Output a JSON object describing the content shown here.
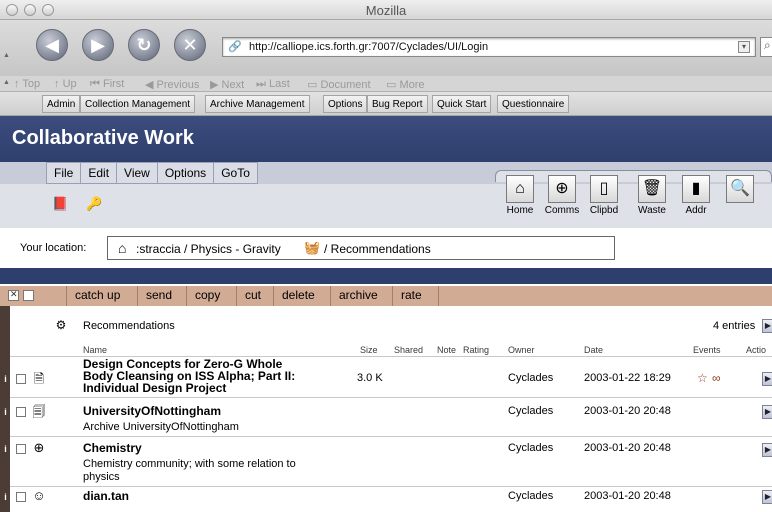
{
  "window": {
    "title": "Mozilla"
  },
  "nav": {
    "url": "http://calliope.ics.forth.gr:7007/Cyclades/UI/Login"
  },
  "sitenav": [
    "Top",
    "Up",
    "First",
    "Previous",
    "Next",
    "Last",
    "Document",
    "More"
  ],
  "ptoolbar": [
    "Admin",
    "Collection Management",
    "Archive Management",
    "Options",
    "Bug Report",
    "Quick Start",
    "Questionnaire"
  ],
  "header": {
    "title": "Collaborative Work"
  },
  "menu": [
    "File",
    "Edit",
    "View",
    "Options",
    "GoTo"
  ],
  "bigbuttons": [
    {
      "label": "Home",
      "icon": "home-icon"
    },
    {
      "label": "Comms",
      "icon": "globe-icon"
    },
    {
      "label": "Clipbd",
      "icon": "clipboard-icon"
    },
    {
      "label": "Waste",
      "icon": "trash-icon"
    },
    {
      "label": "Addr",
      "icon": "address-book-icon"
    },
    {
      "label": "",
      "icon": "search-icon"
    }
  ],
  "location": {
    "label": "Your location:",
    "path_part1": ":straccia / Physics - Gravity",
    "path_part2": "/ Recommendations"
  },
  "actions": [
    "catch up",
    "send",
    "copy",
    "cut",
    "delete",
    "archive",
    "rate"
  ],
  "table": {
    "title": "Recommendations",
    "count": "4 entries",
    "columns": [
      "Name",
      "Size",
      "Shared",
      "Note",
      "Rating",
      "Owner",
      "Date",
      "Events",
      "Actio"
    ],
    "rows": [
      {
        "name": "Design Concepts for Zero-G Whole Body Cleansing on ISS Alpha; Part II: Individual Design Project",
        "name_lines": [
          "Design Concepts for Zero-G Whole",
          "Body Cleansing on ISS Alpha; Part II:",
          "Individual Design Project"
        ],
        "size": "3.0 K",
        "owner": "Cyclades",
        "date": "2003-01-22 18:29",
        "icon": "document-icon"
      },
      {
        "name": "UniversityOfNottingham",
        "desc": "Archive UniversityOfNottingham",
        "owner": "Cyclades",
        "date": "2003-01-20 20:48",
        "icon": "archive-icon"
      },
      {
        "name": "Chemistry",
        "desc_lines": [
          "Chemistry community; with some relation to",
          "physics"
        ],
        "owner": "Cyclades",
        "date": "2003-01-20 20:48",
        "icon": "community-globe-icon"
      },
      {
        "name": "dian.tan",
        "owner": "Cyclades",
        "date": "2003-01-20 20:48",
        "icon": "person-icon"
      }
    ]
  }
}
